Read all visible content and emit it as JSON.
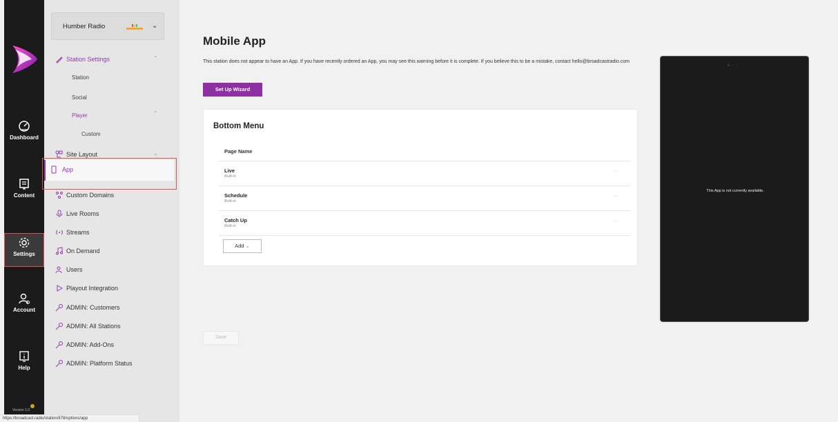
{
  "rail": {
    "items": [
      {
        "label": "Dashboard",
        "icon": "dashboard-icon"
      },
      {
        "label": "Content",
        "icon": "content-icon"
      },
      {
        "label": "Settings",
        "icon": "gear-icon"
      },
      {
        "label": "Account",
        "icon": "account-icon"
      },
      {
        "label": "Help",
        "icon": "help-icon"
      }
    ],
    "version": "Version 1.0"
  },
  "station": {
    "name": "Humber Radio"
  },
  "subnav": {
    "station_settings": "Station Settings",
    "station": "Station",
    "social": "Social",
    "player": "Player",
    "custom": "Custom",
    "site_layout": "Site Layout",
    "app": "App",
    "custom_domains": "Custom Domains",
    "live_rooms": "Live Rooms",
    "streams": "Streams",
    "on_demand": "On Demand",
    "users": "Users",
    "playout": "Playout Integration",
    "admin_customers": "ADMIN: Customers",
    "admin_all_stations": "ADMIN: All Stations",
    "admin_addons": "ADMIN: Add-Ons",
    "admin_platform": "ADMIN: Platform Status"
  },
  "main": {
    "title": "Mobile App",
    "warning": "This station does not appear to have an App. If you have recently ordered an App, you may see this warning before it is complete. If you believe this to be a mistake, contact hello@broadcastradio.com",
    "setup_button": "Set Up Wizard",
    "card_title": "Bottom Menu",
    "column_header": "Page Name",
    "rows": [
      {
        "name": "Live",
        "type": "Built-in"
      },
      {
        "name": "Schedule",
        "type": "Built-in"
      },
      {
        "name": "Catch Up",
        "type": "Built-in"
      }
    ],
    "add_button": "Add",
    "save_button": "Save"
  },
  "phone": {
    "message": "This App is not currently available."
  },
  "status_url": "https://broadcast.radio/station/878/options/app",
  "colors": {
    "accent": "#8e2fa3",
    "rail": "#1b1b1b",
    "highlight": "#d9534f"
  }
}
